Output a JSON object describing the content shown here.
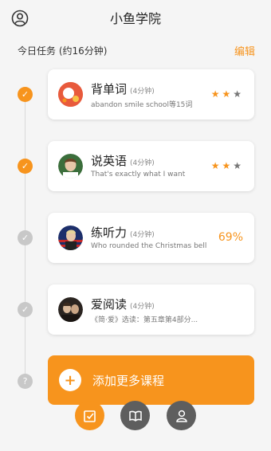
{
  "header": {
    "title": "小鱼学院",
    "profile_icon": "user-circle-icon"
  },
  "subhead": {
    "tasks_label": "今日任务 (约16分钟)",
    "edit_label": "编辑"
  },
  "colors": {
    "accent": "#f7941d",
    "inactive_nav": "#5e5e5e",
    "timeline_dot_pending": "#c8c8c8"
  },
  "courses": [
    {
      "name": "背单词",
      "duration": "(4分钟)",
      "subtitle": "abandon  smile  school等15词",
      "status": "done",
      "rating": 2,
      "rating_max": 3
    },
    {
      "name": "说英语",
      "duration": "(4分钟)",
      "subtitle": "That's exactly what I want",
      "status": "done",
      "rating": 2,
      "rating_max": 3
    },
    {
      "name": "练听力",
      "duration": "(4分钟)",
      "subtitle": "Who rounded the Christmas bell",
      "status": "in-progress",
      "progress": "69%"
    },
    {
      "name": "爱阅读",
      "duration": "(4分钟)",
      "subtitle": "《简·爱》选读：第五章第4部分...",
      "status": "todo"
    }
  ],
  "add_course": {
    "label": "添加更多课程",
    "marker": "?"
  },
  "nav": [
    {
      "icon": "checklist-icon",
      "active": true
    },
    {
      "icon": "book-icon",
      "active": false
    },
    {
      "icon": "person-icon",
      "active": false
    }
  ]
}
